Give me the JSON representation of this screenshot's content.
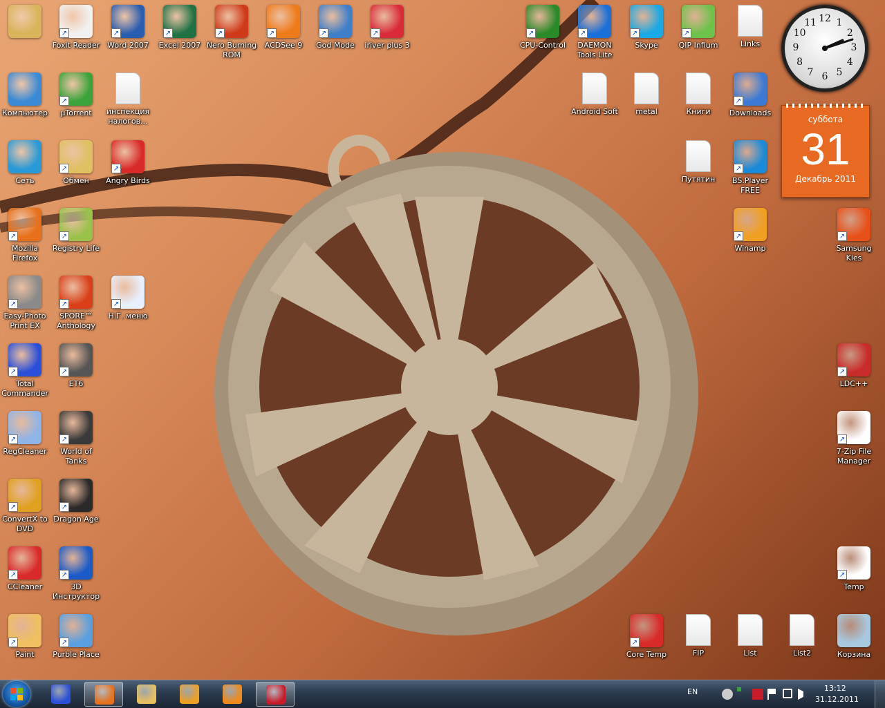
{
  "desktop": {
    "icons": [
      {
        "label": "",
        "icon": "user-folder-icon",
        "color": "#d9b45a"
      },
      {
        "label": "Foxit Reader",
        "icon": "foxit-reader-icon",
        "color": "#f1f1f1"
      },
      {
        "label": "Word 2007",
        "icon": "word-icon",
        "color": "#2a5db0"
      },
      {
        "label": "Excel 2007",
        "icon": "excel-icon",
        "color": "#207245"
      },
      {
        "label": "Nero Burning ROM",
        "icon": "nero-icon",
        "color": "#cf3a1a"
      },
      {
        "label": "ACDSee 9",
        "icon": "acdsee-icon",
        "color": "#ef7a1a"
      },
      {
        "label": "God Mode",
        "icon": "control-panel-icon",
        "color": "#3f7fc9"
      },
      {
        "label": "iriver plus 3",
        "icon": "iriver-icon",
        "color": "#d92a3a"
      },
      {
        "label": "CPU-Control",
        "icon": "chip-icon",
        "color": "#2a8a2a"
      },
      {
        "label": "DAEMON Tools Lite",
        "icon": "daemon-tools-icon",
        "color": "#1a6fd9"
      },
      {
        "label": "Skype",
        "icon": "skype-icon",
        "color": "#19a9e5"
      },
      {
        "label": "QIP Infium",
        "icon": "qip-icon",
        "color": "#6cc24a"
      },
      {
        "label": "Links",
        "icon": "file-icon",
        "color": "#ffffff"
      },
      {
        "label": "Компьютер",
        "icon": "computer-icon",
        "color": "#3a8ad6"
      },
      {
        "label": "µTorrent",
        "icon": "utorrent-icon",
        "color": "#3aa43a"
      },
      {
        "label": "инспекция налогов...",
        "icon": "file-icon",
        "color": "#ffffff"
      },
      {
        "label": "Android Soft",
        "icon": "file-icon",
        "color": "#ffffff"
      },
      {
        "label": "metal",
        "icon": "file-icon",
        "color": "#ffffff"
      },
      {
        "label": "Книги",
        "icon": "file-icon",
        "color": "#ffffff"
      },
      {
        "label": "Downloads",
        "icon": "network-computers-icon",
        "color": "#3a7ad6"
      },
      {
        "label": "Сеть",
        "icon": "network-icon",
        "color": "#2a9ad6"
      },
      {
        "label": "Обмен",
        "icon": "shared-folder-icon",
        "color": "#e0c060"
      },
      {
        "label": "Angry Birds",
        "icon": "angry-birds-icon",
        "color": "#d92a2a"
      },
      {
        "label": "Путятин",
        "icon": "file-icon",
        "color": "#ffffff"
      },
      {
        "label": "BS.Player FREE",
        "icon": "bsplayer-icon",
        "color": "#1a8ad9"
      },
      {
        "label": "Mozilla Firefox",
        "icon": "firefox-icon",
        "color": "#e8701a"
      },
      {
        "label": "Registry Life",
        "icon": "registry-life-icon",
        "color": "#9ac24a"
      },
      {
        "label": "Winamp",
        "icon": "winamp-icon",
        "color": "#f0a020"
      },
      {
        "label": "Samsung Kies",
        "icon": "samsung-kies-icon",
        "color": "#e8501a"
      },
      {
        "label": "Easy-Photo Print EX",
        "icon": "printer-icon",
        "color": "#8a8a8a"
      },
      {
        "label": "SPORE™ Anthology",
        "icon": "spore-icon",
        "color": "#d9401a"
      },
      {
        "label": "Н.Г. меню",
        "icon": "excel-file-icon",
        "color": "#e8f0ff"
      },
      {
        "label": "Total Commander",
        "icon": "floppy-icon",
        "color": "#2a4fd9"
      },
      {
        "label": "ET6",
        "icon": "steering-wheel-icon",
        "color": "#555555"
      },
      {
        "label": "LDC++",
        "icon": "ldcpp-icon",
        "color": "#c92a2a"
      },
      {
        "label": "RegCleaner",
        "icon": "regcleaner-icon",
        "color": "#8fb4e8"
      },
      {
        "label": "World of Tanks",
        "icon": "world-of-tanks-icon",
        "color": "#3a3a3a"
      },
      {
        "label": "7-Zip File Manager",
        "icon": "7zip-icon",
        "color": "#ffffff"
      },
      {
        "label": "ConvertX to DVD",
        "icon": "film-reel-icon",
        "color": "#e0a020"
      },
      {
        "label": "Dragon Age",
        "icon": "dragon-age-icon",
        "color": "#2a2a2a"
      },
      {
        "label": "CCleaner",
        "icon": "ccleaner-icon",
        "color": "#d92a2a"
      },
      {
        "label": "3D Инструктор",
        "icon": "3d-instructor-icon",
        "color": "#1a5ac9"
      },
      {
        "label": "Temp",
        "icon": "red-x-icon",
        "color": "#ffffff"
      },
      {
        "label": "Paint",
        "icon": "paint-icon",
        "color": "#f0c060"
      },
      {
        "label": "Purble Place",
        "icon": "purble-place-icon",
        "color": "#5aa0e0"
      },
      {
        "label": "Core Temp",
        "icon": "thermometer-icon",
        "color": "#d92a2a"
      },
      {
        "label": "FIP",
        "icon": "file-icon",
        "color": "#ffffff"
      },
      {
        "label": "List",
        "icon": "file-icon",
        "color": "#ffffff"
      },
      {
        "label": "List2",
        "icon": "file-icon",
        "color": "#ffffff"
      },
      {
        "label": "Корзина",
        "icon": "recycle-bin-icon",
        "color": "#a8c8e0"
      }
    ]
  },
  "clock_gadget": {
    "hour": 2,
    "minute": 12,
    "numbers": [
      "12",
      "1",
      "2",
      "3",
      "4",
      "5",
      "6",
      "7",
      "8",
      "9",
      "10",
      "11"
    ]
  },
  "calendar_gadget": {
    "weekday": "суббота",
    "day": "31",
    "month_year": "Декабрь 2011",
    "color": "#e86a22"
  },
  "taskbar": {
    "items": [
      {
        "icon": "total-commander-icon",
        "active": false,
        "color": "#2a4fd9"
      },
      {
        "icon": "firefox-icon",
        "active": true,
        "color": "#e8701a"
      },
      {
        "icon": "explorer-folder-icon",
        "active": false,
        "color": "#e8c060"
      },
      {
        "icon": "winamp-icon",
        "active": false,
        "color": "#f0a020"
      },
      {
        "icon": "media-player-icon",
        "active": false,
        "color": "#f08a1a"
      },
      {
        "icon": "kaspersky-icon",
        "active": true,
        "color": "#c91a2a"
      }
    ],
    "tray": {
      "language": "EN",
      "time": "13:12",
      "date": "31.12.2011"
    }
  }
}
